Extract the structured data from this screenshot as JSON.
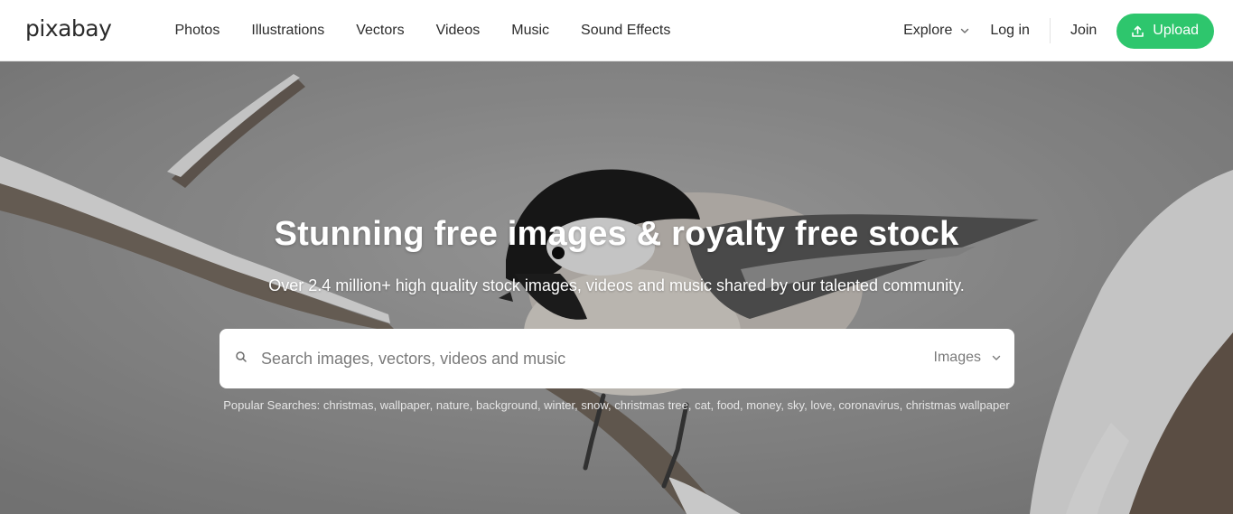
{
  "header": {
    "logo": "pixabay",
    "nav": [
      "Photos",
      "Illustrations",
      "Vectors",
      "Videos",
      "Music",
      "Sound Effects"
    ],
    "explore_label": "Explore",
    "login_label": "Log in",
    "join_label": "Join",
    "upload_label": "Upload"
  },
  "hero": {
    "title": "Stunning free images & royalty free stock",
    "subtitle": "Over 2.4 million+ high quality stock images, videos and music shared by our talented community."
  },
  "search": {
    "placeholder": "Search images, vectors, videos and music",
    "value": "",
    "type_selected": "Images"
  },
  "popular": {
    "label": "Popular Searches:",
    "terms": [
      "christmas",
      "wallpaper",
      "nature",
      "background",
      "winter",
      "snow",
      "christmas tree",
      "cat",
      "food",
      "money",
      "sky",
      "love",
      "coronavirus",
      "christmas wallpaper"
    ]
  },
  "colors": {
    "accent": "#2ec66d",
    "text": "#2b2b2b",
    "header_bg": "#ffffff"
  },
  "icons": {
    "upload": "upload-arrow-icon",
    "search": "search-icon",
    "chevron": "chevron-down-icon"
  }
}
